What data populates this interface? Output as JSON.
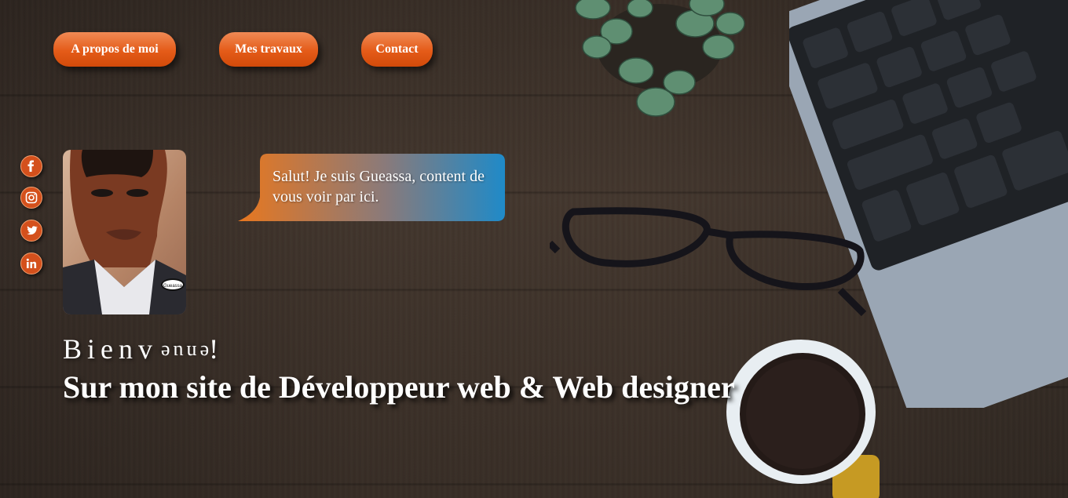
{
  "nav": {
    "about_label": "A propos de moi",
    "works_label": "Mes travaux",
    "contact_label": "Contact"
  },
  "social": [
    {
      "name": "facebook-icon"
    },
    {
      "name": "instagram-icon"
    },
    {
      "name": "twitter-icon"
    },
    {
      "name": "linkedin-icon"
    }
  ],
  "avatar": {
    "badge_text": "Gueassa"
  },
  "bubble": {
    "text": "Salut! Je suis Gueassa, content de vous voir par ici."
  },
  "hero": {
    "welcome_start": "Bienv",
    "welcome_flipped": "enue",
    "welcome_end": "!",
    "tagline": "Sur mon site de Développeur web & Web designer"
  },
  "colors": {
    "accent": "#e45b18",
    "bubble_start": "#e8771f",
    "bubble_end": "#1f8ac8"
  }
}
